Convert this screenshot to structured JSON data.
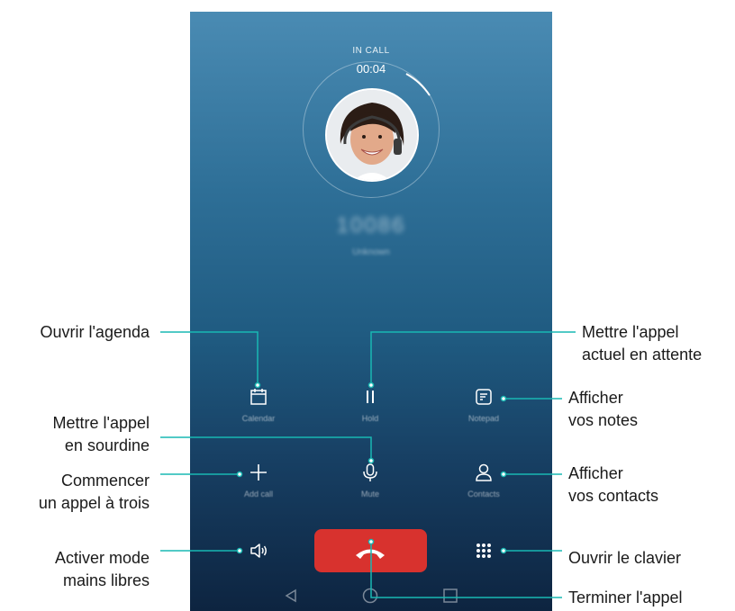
{
  "call": {
    "status": "IN CALL",
    "timer": "00:04",
    "number": "10086",
    "number_sub": "Unknown"
  },
  "buttons": {
    "calendar": "Calendar",
    "hold": "Hold",
    "notepad": "Notepad",
    "add_call": "Add call",
    "mute": "Mute",
    "contacts": "Contacts"
  },
  "callouts": {
    "calendar": "Ouvrir l'agenda",
    "hold_1": "Mettre l'appel",
    "hold_2": "actuel en attente",
    "notes_1": "Afficher",
    "notes_2": "vos notes",
    "mute_1": "Mettre l'appel",
    "mute_2": "en sourdine",
    "addcall_1": "Commencer",
    "addcall_2": "un appel à trois",
    "contacts_1": "Afficher",
    "contacts_2": "vos contacts",
    "speaker_1": "Activer mode",
    "speaker_2": "mains libres",
    "dialpad": "Ouvrir le clavier",
    "endcall": "Terminer l'appel"
  },
  "colors": {
    "accent_line": "#19b8b3",
    "end_call": "#d8322e"
  },
  "icons": [
    "calendar-icon",
    "hold-icon",
    "notepad-icon",
    "add-call-icon",
    "mute-icon",
    "contacts-icon",
    "speaker-icon",
    "dialpad-icon",
    "end-call-icon",
    "back-icon",
    "home-icon",
    "recents-icon"
  ]
}
